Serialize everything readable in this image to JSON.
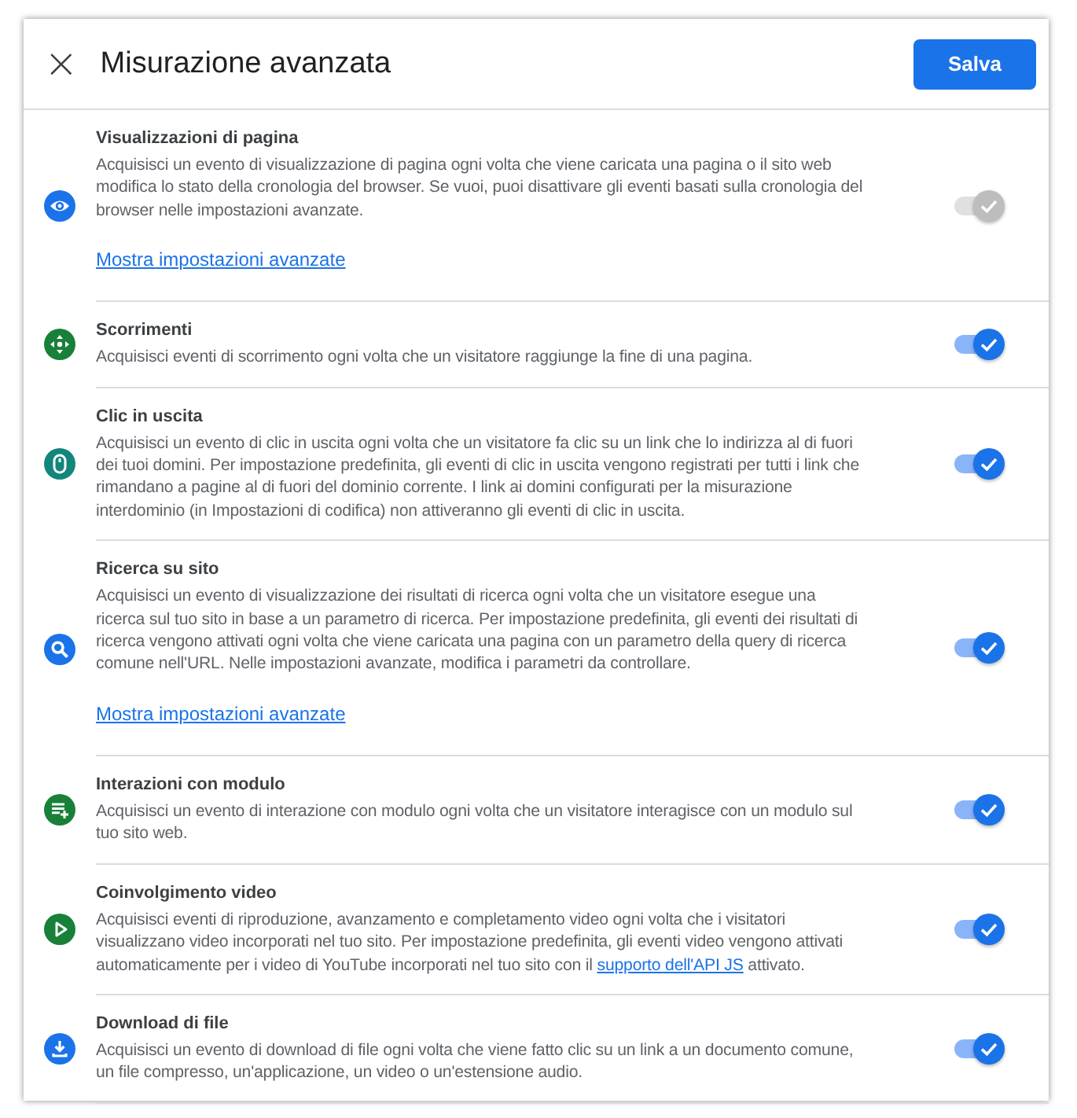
{
  "header": {
    "close": "×",
    "title": "Misurazione avanzata",
    "save": "Salva"
  },
  "items": [
    {
      "kind": "eye",
      "color": "#1a73e8",
      "title": "Visualizzazioni di pagina",
      "description": [
        {
          "kind": "text",
          "text": "Acquisisci un evento di visualizzazione di pagina ogni volta che viene caricata una pagina o il sito web modifica lo stato della cronologia del browser. Se vuoi, puoi disattivare gli eventi basati sulla cronologia del browser nelle impostazioni avanzate."
        }
      ],
      "advanced_link": "Mostra impostazioni avanzate",
      "on": true,
      "disabled": true
    },
    {
      "kind": "scroll",
      "color": "#188038",
      "title": "Scorrimenti",
      "description": [
        {
          "kind": "text",
          "text": "Acquisisci eventi di scorrimento ogni volta che un visitatore raggiunge la fine di una pagina."
        }
      ],
      "on": true,
      "disabled": false
    },
    {
      "kind": "mouse",
      "color": "#12867a",
      "title": "Clic in uscita",
      "description": [
        {
          "kind": "text",
          "text": "Acquisisci un evento di clic in uscita ogni volta che un visitatore fa clic su un link che lo indirizza al di fuori dei tuoi domini. Per impostazione predefinita, gli eventi di clic in uscita vengono registrati per tutti i link che rimandano a pagine al di fuori del dominio corrente. I link ai domini configurati per la misurazione interdominio (in Impostazioni di codifica) non attiveranno gli eventi di clic in uscita."
        }
      ],
      "on": true,
      "disabled": false
    },
    {
      "kind": "search",
      "color": "#1a73e8",
      "title": "Ricerca su sito",
      "description": [
        {
          "kind": "text",
          "text": "Acquisisci un evento di visualizzazione dei risultati di ricerca ogni volta che un visitatore esegue una ricerca sul tuo sito in base a un parametro di ricerca. Per impostazione predefinita, gli eventi dei risultati di ricerca vengono attivati ogni volta che viene caricata una pagina con un parametro della query di ricerca comune nell'URL. Nelle impostazioni avanzate, modifica i parametri da controllare."
        }
      ],
      "advanced_link": "Mostra impostazioni avanzate",
      "on": true,
      "disabled": false
    },
    {
      "kind": "form",
      "color": "#188038",
      "title": "Interazioni con modulo",
      "description": [
        {
          "kind": "text",
          "text": "Acquisisci un evento di interazione con modulo ogni volta che un visitatore interagisce con un modulo sul tuo sito web."
        }
      ],
      "on": true,
      "disabled": false
    },
    {
      "kind": "play",
      "color": "#188038",
      "title": "Coinvolgimento video",
      "description": [
        {
          "kind": "text",
          "text": "Acquisisci eventi di riproduzione, avanzamento e completamento video ogni volta che i visitatori visualizzano video incorporati nel tuo sito. Per impostazione predefinita, gli eventi video vengono attivati automaticamente per i video di YouTube incorporati nel tuo sito con il "
        },
        {
          "kind": "link",
          "text": "supporto dell'API JS"
        },
        {
          "kind": "text",
          "text": " attivato."
        }
      ],
      "on": true,
      "disabled": false
    },
    {
      "kind": "download",
      "color": "#1a73e8",
      "title": "Download di file",
      "description": [
        {
          "kind": "text",
          "text": "Acquisisci un evento di download di file ogni volta che viene fatto clic su un link a un documento comune, un file compresso, un'applicazione, un video o un'estensione audio."
        }
      ],
      "on": true,
      "disabled": false
    }
  ]
}
